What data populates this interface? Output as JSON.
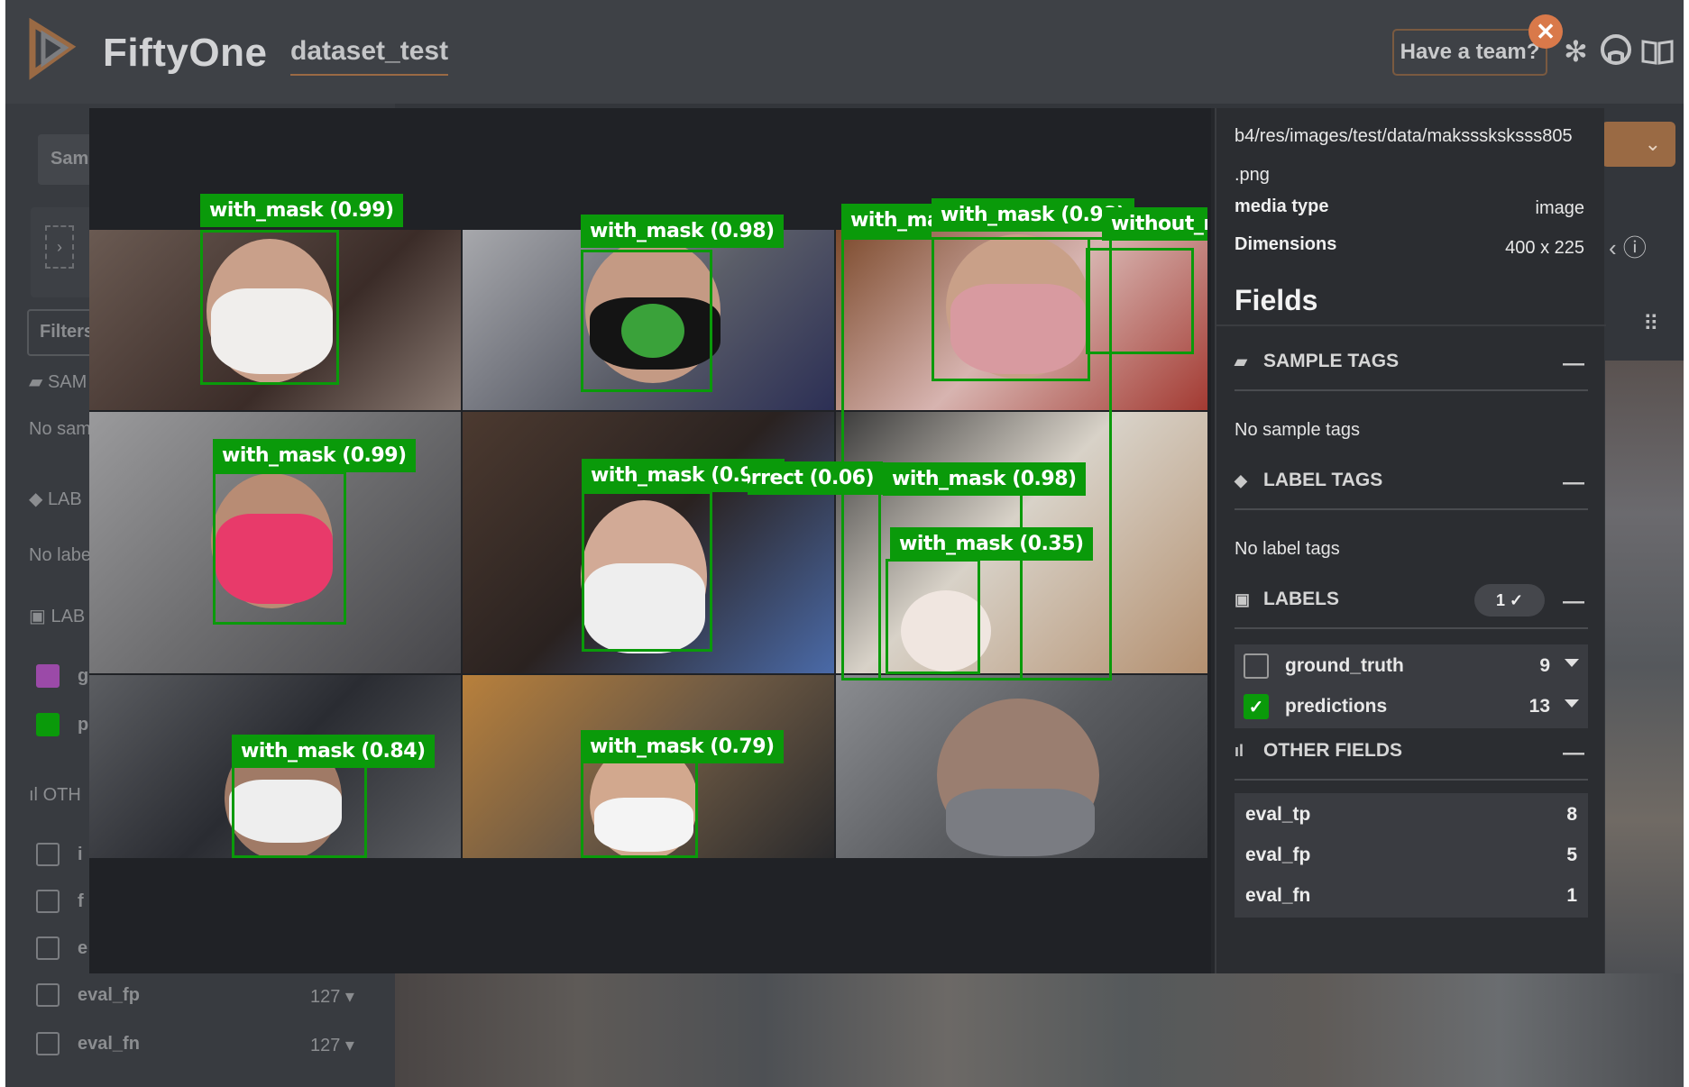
{
  "header": {
    "brand": "FiftyOne",
    "dataset": "dataset_test",
    "team_button": "Have a team?",
    "icons": [
      "slack-icon",
      "github-icon",
      "docs-icon"
    ]
  },
  "background": {
    "samples_tab": "Samp",
    "filters": "Filters",
    "sample_tags_short": "SAM",
    "no_sample_short": "No sam",
    "label_tags_short": "LAB",
    "no_label_short": "No labe",
    "labels_short": "LAB",
    "other_short": "OTH",
    "rows": [
      {
        "label": "g",
        "checked": true,
        "color": "#9b4aa8"
      },
      {
        "label": "p",
        "checked": true,
        "color": "#0a9a0a"
      },
      {
        "label": "i",
        "checked": false
      },
      {
        "label": "f",
        "checked": false
      },
      {
        "label": "e",
        "checked": false
      },
      {
        "label": "eval_fp",
        "count": "127",
        "checked": false
      },
      {
        "label": "eval_fn",
        "count": "127",
        "checked": false
      }
    ]
  },
  "viewer": {
    "labels": {
      "l1": "with_mask (0.99)",
      "l2": "with_mask (0.98)",
      "l3": "with_ma",
      "l4": "with_mask (0.98)",
      "l5": "without_m",
      "l6": "with_mask (0.99)",
      "l7": "with_mask (0.97)",
      "l8": "orrect (0.06)",
      "l9": "with_mask (0.98)",
      "l10": "with_mask (0.35)",
      "l11": "with_mask (0.84)",
      "l12": "with_mask (0.79)"
    },
    "box_color": "#0a9a0a"
  },
  "panel": {
    "filepath_line1": "b4/res/images/test/data/maksssksksss805",
    "filepath_line2": ".png",
    "media_type_key": "media type",
    "media_type_val": "image",
    "dimensions_key": "Dimensions",
    "dimensions_val": "400 x 225",
    "fields_title": "Fields",
    "sample_tags": {
      "title": "SAMPLE TAGS",
      "note": "No sample tags"
    },
    "label_tags": {
      "title": "LABEL TAGS",
      "note": "No label tags"
    },
    "labels": {
      "title": "LABELS",
      "pill": "1 ✓",
      "items": [
        {
          "name": "ground_truth",
          "count": "9",
          "checked": false
        },
        {
          "name": "predictions",
          "count": "13",
          "checked": true
        }
      ]
    },
    "other_fields": {
      "title": "OTHER FIELDS",
      "items": [
        {
          "name": "eval_tp",
          "value": "8"
        },
        {
          "name": "eval_fp",
          "value": "5"
        },
        {
          "name": "eval_fn",
          "value": "1"
        }
      ]
    }
  }
}
